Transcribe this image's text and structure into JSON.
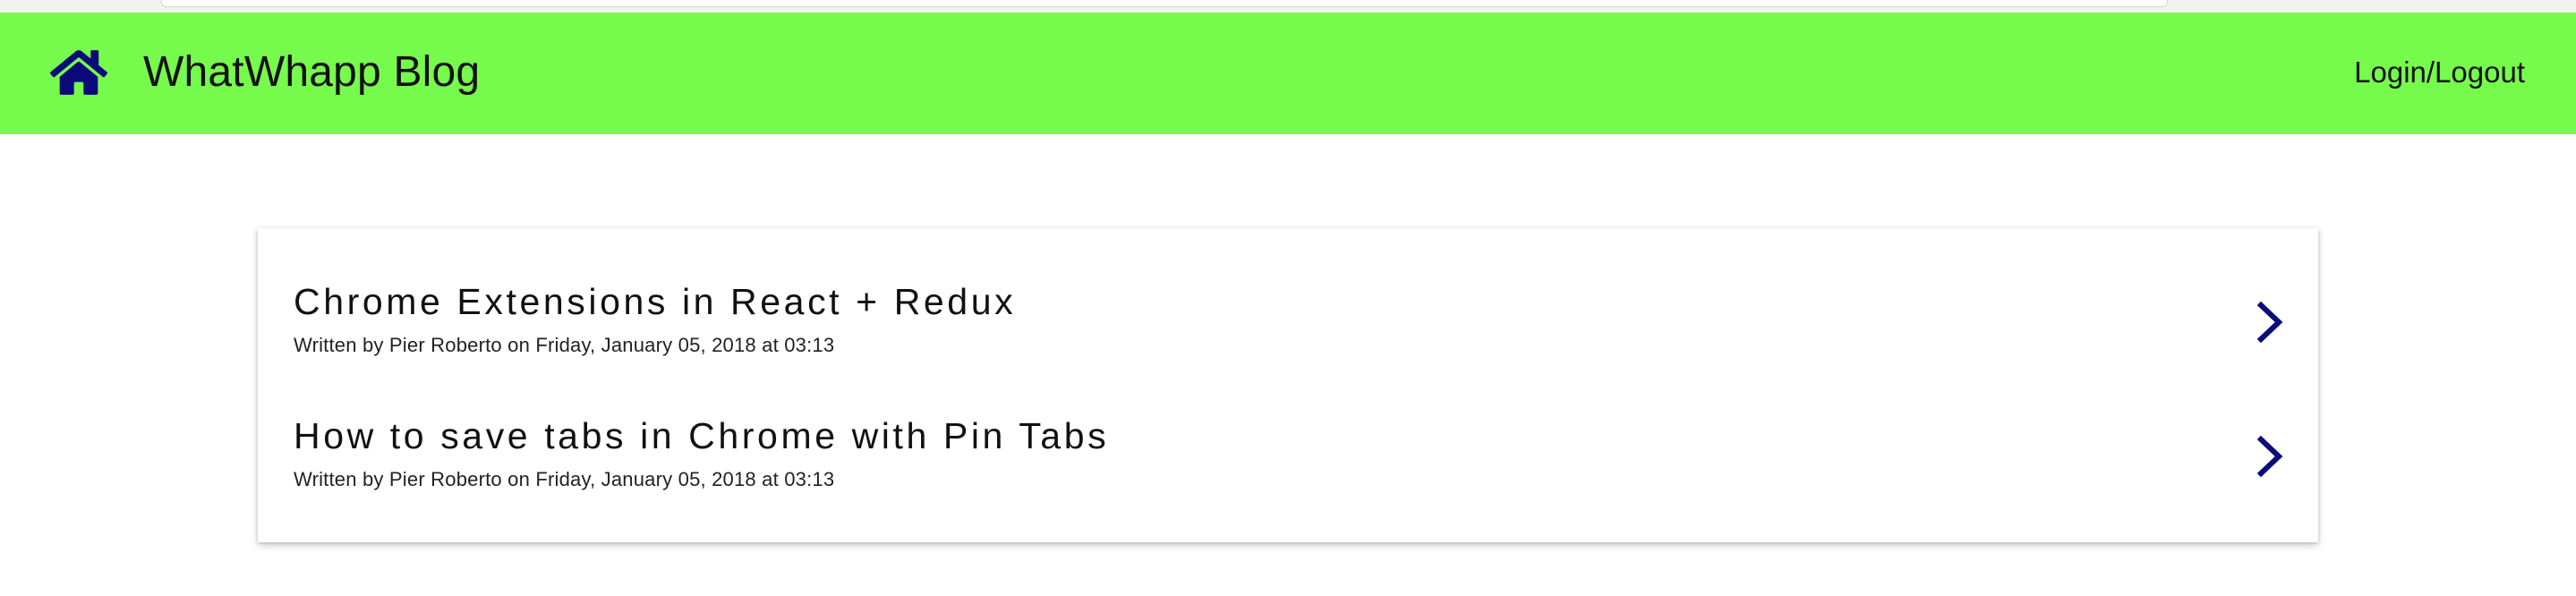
{
  "app": {
    "title": "WhatWhapp Blog",
    "home_icon": "home-icon",
    "login_label": "Login/Logout",
    "bar_color": "#76fb4c",
    "accent_color": "#0a0a7a"
  },
  "posts": [
    {
      "title": "Chrome Extensions in React + Redux",
      "meta": "Written by Pier Roberto on Friday, January 05, 2018 at 03:13",
      "icon": "chevron-right-icon"
    },
    {
      "title": "How to save tabs in Chrome with Pin Tabs",
      "meta": "Written by Pier Roberto on Friday, January 05, 2018 at 03:13",
      "icon": "chevron-right-icon"
    }
  ]
}
